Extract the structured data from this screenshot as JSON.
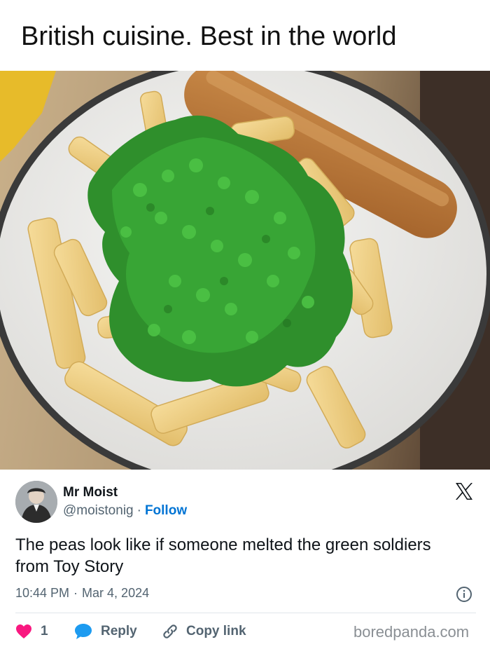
{
  "caption": "British cuisine. Best in the world",
  "tweet": {
    "author_name": "Mr Moist",
    "handle": "@moistonig",
    "separator": "·",
    "follow_label": "Follow",
    "text": "The peas look like if someone melted the green soldiers from Toy Story",
    "time": "10:44 PM",
    "date": "Mar 4, 2024",
    "likes": "1",
    "reply_label": "Reply",
    "copy_link_label": "Copy link"
  },
  "watermark": "boredpanda.com",
  "colors": {
    "like_heart": "#f91880",
    "reply_bubble": "#1d9bf0",
    "follow_link": "#0074d4",
    "muted_text": "#536471"
  },
  "icons": {
    "platform": "x-logo-icon",
    "info": "info-icon",
    "like": "heart-icon",
    "reply": "speech-bubble-icon",
    "copy": "link-icon"
  }
}
